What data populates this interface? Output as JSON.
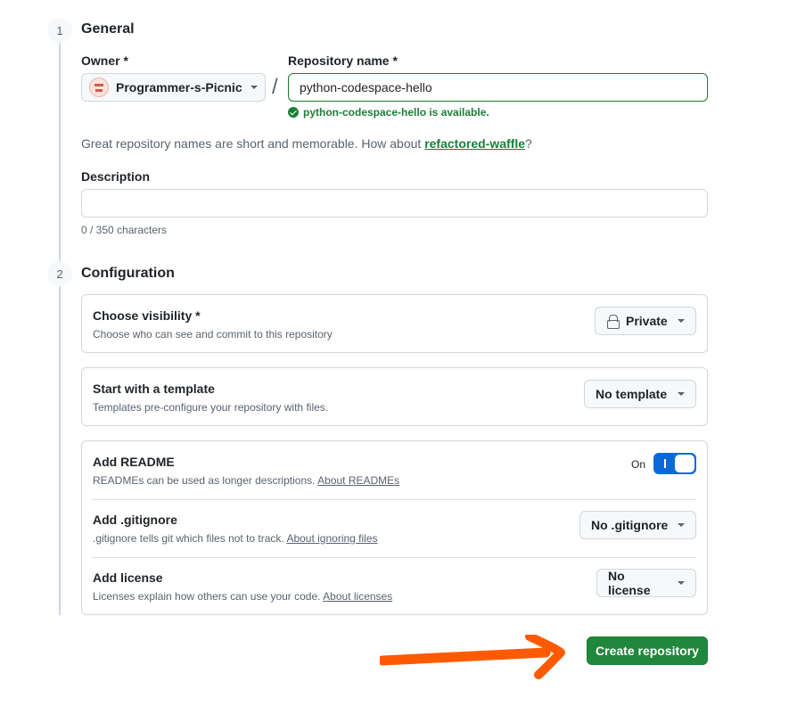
{
  "general": {
    "step": "1",
    "title": "General",
    "owner_label": "Owner *",
    "owner_value": "Programmer-s-Picnic",
    "repo_label": "Repository name *",
    "separator": "/",
    "repo_value": "python-codespace-hello",
    "availability": "python-codespace-hello is available.",
    "hint_prefix": "Great repository names are short and memorable. How about ",
    "hint_suggestion": "refactored-waffle",
    "hint_suffix": "?",
    "description_label": "Description",
    "description_value": "",
    "char_count": "0 / 350 characters"
  },
  "configuration": {
    "step": "2",
    "title": "Configuration",
    "visibility": {
      "title": "Choose visibility *",
      "subtitle": "Choose who can see and commit to this repository",
      "value": "Private",
      "icon": "lock-icon"
    },
    "template": {
      "title": "Start with a template",
      "subtitle": "Templates pre-configure your repository with files.",
      "value": "No template"
    },
    "readme": {
      "title": "Add README",
      "subtitle": "READMEs can be used as longer descriptions. ",
      "link": "About READMEs",
      "toggle_label": "On",
      "toggle_on": true
    },
    "gitignore": {
      "title": "Add .gitignore",
      "subtitle": ".gitignore tells git which files not to track. ",
      "link": "About ignoring files",
      "value": "No .gitignore"
    },
    "license": {
      "title": "Add license",
      "subtitle": "Licenses explain how others can use your code. ",
      "link": "About licenses",
      "value": "No license"
    }
  },
  "create_button": "Create repository",
  "colors": {
    "primary_green": "#1f883d",
    "toggle_blue": "#0969da",
    "annotation_arrow": "#ff5a00"
  }
}
